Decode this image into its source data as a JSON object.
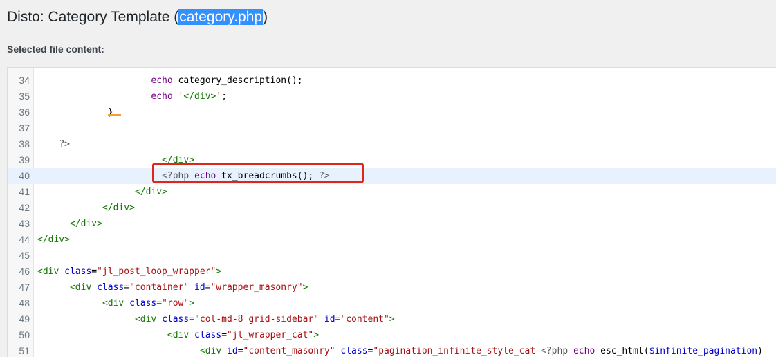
{
  "header": {
    "title_prefix": "Disto: Category Template (",
    "title_file": "category.php",
    "title_suffix": ")",
    "subtitle": "Selected file content:"
  },
  "editor": {
    "top_fragment": ", ,",
    "lines": [
      {
        "num": "34",
        "indent": 21,
        "tokens": [
          {
            "t": "kw",
            "v": "echo"
          },
          {
            "t": "fn",
            "v": " category_description();"
          }
        ]
      },
      {
        "num": "35",
        "indent": 21,
        "tokens": [
          {
            "t": "kw",
            "v": "echo"
          },
          {
            "t": "str",
            "v": " '"
          },
          {
            "t": "tag",
            "v": "</div>"
          },
          {
            "t": "str",
            "v": "'"
          },
          {
            "t": "fn",
            "v": ";"
          }
        ]
      },
      {
        "num": "36",
        "indent": 13,
        "tokens": [
          {
            "t": "fn",
            "v": "}"
          }
        ]
      },
      {
        "num": "37",
        "indent": 0,
        "tokens": []
      },
      {
        "num": "38",
        "indent": 4,
        "tokens": [
          {
            "t": "meta",
            "v": "?>"
          }
        ]
      },
      {
        "num": "39",
        "indent": 23,
        "tokens": [
          {
            "t": "tag",
            "v": "</div>"
          }
        ]
      },
      {
        "num": "40",
        "indent": 23,
        "active": true,
        "tokens": [
          {
            "t": "meta",
            "v": "<?php "
          },
          {
            "t": "kw",
            "v": "echo"
          },
          {
            "t": "fn",
            "v": " tx_breadcrumbs(); "
          },
          {
            "t": "meta",
            "v": "?>"
          }
        ]
      },
      {
        "num": "41",
        "indent": 18,
        "tokens": [
          {
            "t": "tag",
            "v": "</div>"
          }
        ]
      },
      {
        "num": "42",
        "indent": 12,
        "tokens": [
          {
            "t": "tag",
            "v": "</div>"
          }
        ]
      },
      {
        "num": "43",
        "indent": 6,
        "tokens": [
          {
            "t": "tag",
            "v": "</div>"
          }
        ]
      },
      {
        "num": "44",
        "indent": 0,
        "tokens": [
          {
            "t": "tag",
            "v": "</div>"
          }
        ]
      },
      {
        "num": "45",
        "indent": 0,
        "tokens": []
      },
      {
        "num": "46",
        "indent": 0,
        "tokens": [
          {
            "t": "tag",
            "v": "<div "
          },
          {
            "t": "attr",
            "v": "class"
          },
          {
            "t": "fn",
            "v": "="
          },
          {
            "t": "str",
            "v": "\"jl_post_loop_wrapper\""
          },
          {
            "t": "tag",
            "v": ">"
          }
        ]
      },
      {
        "num": "47",
        "indent": 6,
        "tokens": [
          {
            "t": "tag",
            "v": "<div "
          },
          {
            "t": "attr",
            "v": "class"
          },
          {
            "t": "fn",
            "v": "="
          },
          {
            "t": "str",
            "v": "\"container\""
          },
          {
            "t": "fn",
            "v": " "
          },
          {
            "t": "attr",
            "v": "id"
          },
          {
            "t": "fn",
            "v": "="
          },
          {
            "t": "str",
            "v": "\"wrapper_masonry\""
          },
          {
            "t": "tag",
            "v": ">"
          }
        ]
      },
      {
        "num": "48",
        "indent": 12,
        "tokens": [
          {
            "t": "tag",
            "v": "<div "
          },
          {
            "t": "attr",
            "v": "class"
          },
          {
            "t": "fn",
            "v": "="
          },
          {
            "t": "str",
            "v": "\"row\""
          },
          {
            "t": "tag",
            "v": ">"
          }
        ]
      },
      {
        "num": "49",
        "indent": 18,
        "tokens": [
          {
            "t": "tag",
            "v": "<div "
          },
          {
            "t": "attr",
            "v": "class"
          },
          {
            "t": "fn",
            "v": "="
          },
          {
            "t": "str",
            "v": "\"col-md-8 grid-sidebar\""
          },
          {
            "t": "fn",
            "v": " "
          },
          {
            "t": "attr",
            "v": "id"
          },
          {
            "t": "fn",
            "v": "="
          },
          {
            "t": "str",
            "v": "\"content\""
          },
          {
            "t": "tag",
            "v": ">"
          }
        ]
      },
      {
        "num": "50",
        "indent": 24,
        "tokens": [
          {
            "t": "tag",
            "v": "<div "
          },
          {
            "t": "attr",
            "v": "class"
          },
          {
            "t": "fn",
            "v": "="
          },
          {
            "t": "str",
            "v": "\"jl_wrapper_cat\""
          },
          {
            "t": "tag",
            "v": ">"
          }
        ]
      },
      {
        "num": "51",
        "indent": 30,
        "tokens": [
          {
            "t": "tag",
            "v": "<div "
          },
          {
            "t": "attr",
            "v": "id"
          },
          {
            "t": "fn",
            "v": "="
          },
          {
            "t": "str",
            "v": "\"content_masonry\""
          },
          {
            "t": "fn",
            "v": " "
          },
          {
            "t": "attr",
            "v": "class"
          },
          {
            "t": "fn",
            "v": "="
          },
          {
            "t": "str",
            "v": "\"pagination_infinite_style_cat "
          },
          {
            "t": "meta",
            "v": "<?php "
          },
          {
            "t": "kw",
            "v": "echo"
          },
          {
            "t": "fn",
            "v": " esc_html("
          },
          {
            "t": "attr",
            "v": "$infinite_pagination"
          },
          {
            "t": "fn",
            "v": ")"
          }
        ]
      }
    ]
  }
}
